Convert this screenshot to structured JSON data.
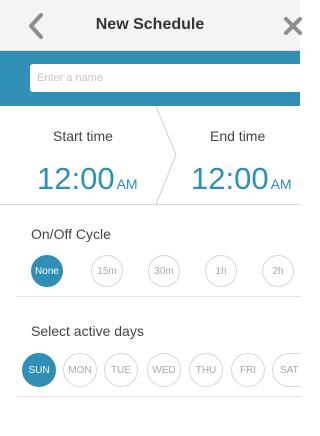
{
  "header": {
    "title": "New Schedule"
  },
  "name_field": {
    "placeholder": "Enter a name",
    "value": ""
  },
  "time": {
    "start_label": "Start time",
    "start_value": "12:00",
    "start_ampm": "AM",
    "end_label": "End time",
    "end_value": "12:00",
    "end_ampm": "AM"
  },
  "cycle": {
    "title": "On/Off Cycle",
    "selected": "None",
    "options": [
      "None",
      "15m",
      "30m",
      "1h",
      "2h"
    ]
  },
  "days": {
    "title": "Select active days",
    "selected": [
      "SUN"
    ],
    "options": [
      "SUN",
      "MON",
      "TUE",
      "WED",
      "THU",
      "FRI",
      "SAT"
    ]
  },
  "colors": {
    "accent": "#2f8fb5",
    "chip_border": "#d6d6d6",
    "chip_text": "#a8a8a8"
  },
  "icons": {
    "back": "chevron-left-icon",
    "close": "close-icon"
  }
}
